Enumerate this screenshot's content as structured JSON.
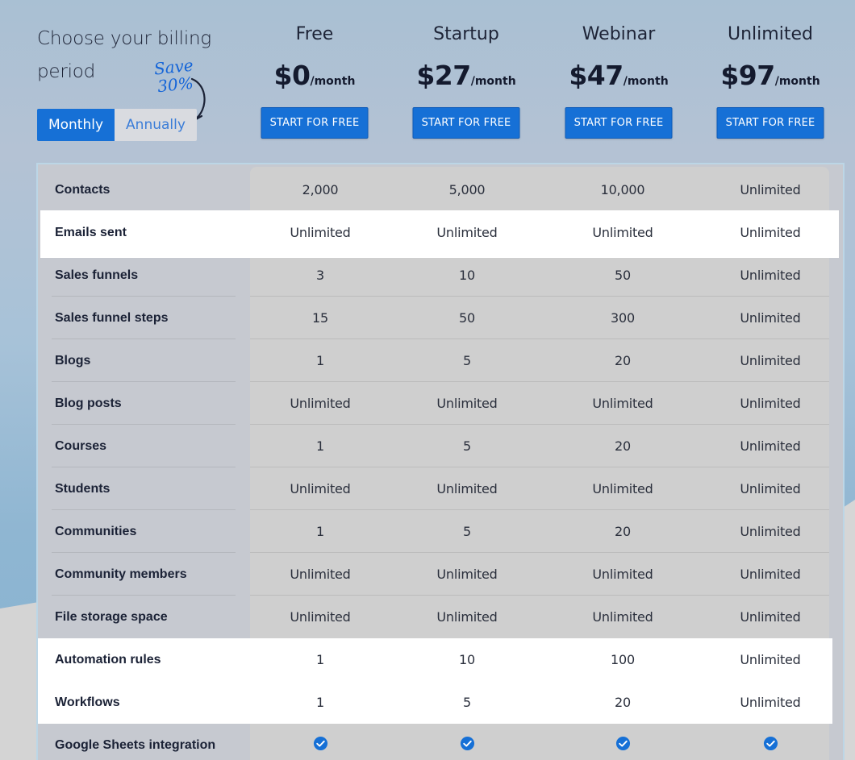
{
  "billing": {
    "title": "Choose your billing period",
    "save_note_line1": "Save",
    "save_note_line2": "30%",
    "toggle": {
      "monthly": "Monthly",
      "annually": "Annually",
      "selected": "Monthly"
    }
  },
  "plans": [
    {
      "name": "Free",
      "amount": "$0",
      "period": "/month",
      "cta": "START FOR FREE"
    },
    {
      "name": "Startup",
      "amount": "$27",
      "period": "/month",
      "cta": "START FOR FREE"
    },
    {
      "name": "Webinar",
      "amount": "$47",
      "period": "/month",
      "cta": "START FOR FREE"
    },
    {
      "name": "Unlimited",
      "amount": "$97",
      "period": "/month",
      "cta": "START FOR FREE"
    }
  ],
  "features": [
    {
      "name": "Contacts",
      "values": [
        "2,000",
        "5,000",
        "10,000",
        "Unlimited"
      ]
    },
    {
      "name": "Emails sent",
      "values": [
        "Unlimited",
        "Unlimited",
        "Unlimited",
        "Unlimited"
      ]
    },
    {
      "name": "Sales funnels",
      "values": [
        "3",
        "10",
        "50",
        "Unlimited"
      ]
    },
    {
      "name": "Sales funnel steps",
      "values": [
        "15",
        "50",
        "300",
        "Unlimited"
      ]
    },
    {
      "name": "Blogs",
      "values": [
        "1",
        "5",
        "20",
        "Unlimited"
      ]
    },
    {
      "name": "Blog posts",
      "values": [
        "Unlimited",
        "Unlimited",
        "Unlimited",
        "Unlimited"
      ]
    },
    {
      "name": "Courses",
      "values": [
        "1",
        "5",
        "20",
        "Unlimited"
      ]
    },
    {
      "name": "Students",
      "values": [
        "Unlimited",
        "Unlimited",
        "Unlimited",
        "Unlimited"
      ]
    },
    {
      "name": "Communities",
      "values": [
        "1",
        "5",
        "20",
        "Unlimited"
      ]
    },
    {
      "name": "Community members",
      "values": [
        "Unlimited",
        "Unlimited",
        "Unlimited",
        "Unlimited"
      ]
    },
    {
      "name": "File storage space",
      "values": [
        "Unlimited",
        "Unlimited",
        "Unlimited",
        "Unlimited"
      ]
    },
    {
      "name": "Automation rules",
      "values": [
        "1",
        "10",
        "100",
        "Unlimited"
      ]
    },
    {
      "name": "Workflows",
      "values": [
        "1",
        "5",
        "20",
        "Unlimited"
      ]
    },
    {
      "name": "Google Sheets integration",
      "values": [
        "check",
        "check",
        "check",
        "check"
      ]
    }
  ],
  "colors": {
    "accent": "#1670d6",
    "text": "#1b2236",
    "highlight_row": "#ffffff"
  }
}
